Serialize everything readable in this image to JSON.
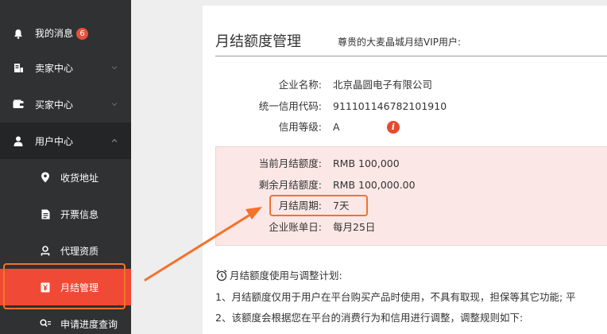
{
  "sidebar": {
    "items": [
      {
        "label": "我的消息",
        "badge": "6",
        "icon": "bell-icon"
      },
      {
        "label": "卖家中心",
        "icon": "store-icon"
      },
      {
        "label": "买家中心",
        "icon": "wallet-icon"
      },
      {
        "label": "用户中心",
        "icon": "user-icon"
      }
    ],
    "subitems": [
      {
        "label": "收货地址",
        "icon": "location-pin-icon"
      },
      {
        "label": "开票信息",
        "icon": "invoice-document-icon"
      },
      {
        "label": "代理资质",
        "icon": "agent-person-icon"
      },
      {
        "label": "月结管理",
        "icon": "yen-icon"
      },
      {
        "label": "申请进度查询",
        "icon": "search-list-icon"
      }
    ]
  },
  "header": {
    "title": "月结额度管理",
    "subtitle": "尊贵的大麦晶城月结VIP用户:"
  },
  "company": {
    "name_label": "企业名称:",
    "name_value": "北京晶圆电子有限公司",
    "code_label": "统一信用代码:",
    "code_value": "911101146782101910",
    "level_label": "信用等级:",
    "level_value": "A"
  },
  "credit": {
    "current_label": "当前月结额度:",
    "current_value": "RMB 100,000",
    "remaining_label": "剩余月结额度:",
    "remaining_value": "RMB 100,000.00",
    "period_label": "月结周期:",
    "period_value": "7天",
    "billing_label": "企业账单日:",
    "billing_value": "每月25日"
  },
  "plan": {
    "title": "月结额度使用与调整计划:",
    "line1": "1、月结额度仅用于用户在平台购买产品时使用，不具有取现，担保等其它功能; 平",
    "line2": "2、该额度会根据您在平台的消费行为和信用进行调整，调整规则如下:"
  },
  "colors": {
    "sidebar_bg": "#2f3133",
    "active_bg": "#f04a36",
    "highlight_outline": "#f4722b",
    "panel_bg": "#fbe8e6"
  }
}
